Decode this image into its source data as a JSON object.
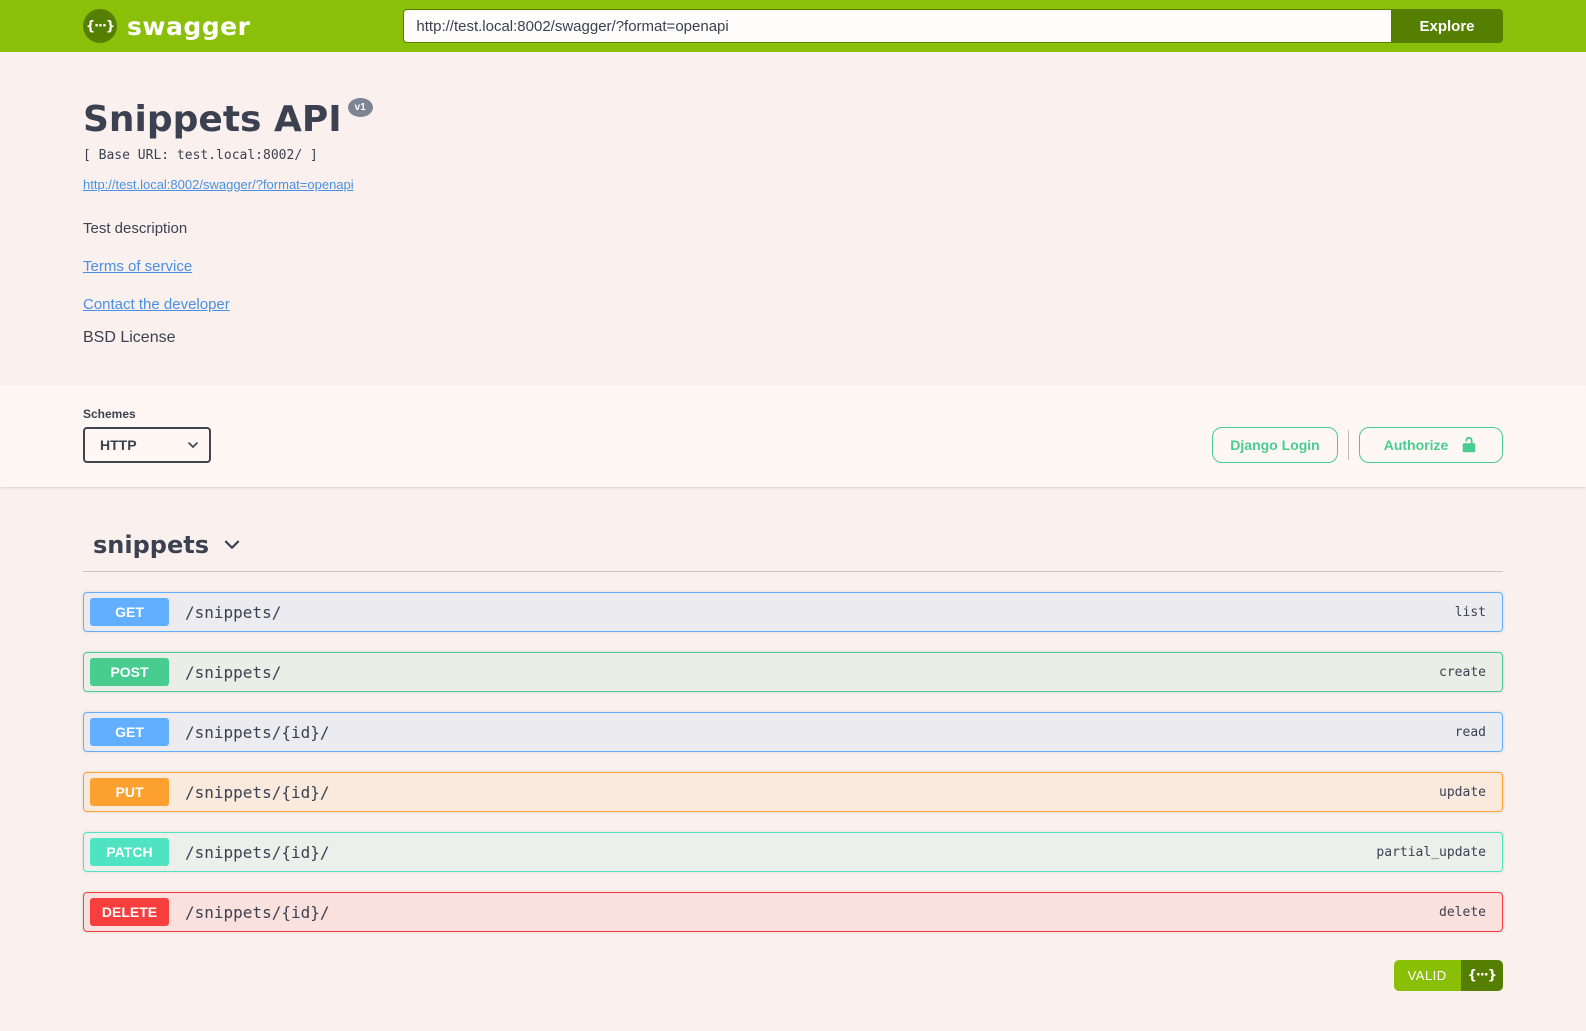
{
  "topbar": {
    "brand": "swagger",
    "logo_glyph": "{···}",
    "url_value": "http://test.local:8002/swagger/?format=openapi",
    "explore_label": "Explore"
  },
  "info": {
    "title": "Snippets API",
    "version_badge": "v1",
    "base_url_text": "[ Base URL: test.local:8002/ ]",
    "spec_link": "http://test.local:8002/swagger/?format=openapi",
    "description": "Test description",
    "terms_link": "Terms of service",
    "contact_link": "Contact the developer",
    "license": "BSD License"
  },
  "schemes": {
    "label": "Schemes",
    "selected": "HTTP"
  },
  "auth": {
    "django_login_label": "Django Login",
    "authorize_label": "Authorize"
  },
  "tag": {
    "name": "snippets"
  },
  "operations": [
    {
      "method": "GET",
      "path": "/snippets/",
      "summary": "list",
      "color": "#61affe"
    },
    {
      "method": "POST",
      "path": "/snippets/",
      "summary": "create",
      "color": "#49cc90"
    },
    {
      "method": "GET",
      "path": "/snippets/{id}/",
      "summary": "read",
      "color": "#61affe"
    },
    {
      "method": "PUT",
      "path": "/snippets/{id}/",
      "summary": "update",
      "color": "#fca130"
    },
    {
      "method": "PATCH",
      "path": "/snippets/{id}/",
      "summary": "partial_update",
      "color": "#50e3c2"
    },
    {
      "method": "DELETE",
      "path": "/snippets/{id}/",
      "summary": "delete",
      "color": "#f93e3e"
    }
  ],
  "valid_badge": {
    "label": "VALID",
    "braces": "{···}"
  },
  "colors": {
    "topbar_green": "#8bc00a",
    "dark_green": "#547f00",
    "valid_green": "#89bf04",
    "auth_green": "#49cc90",
    "link_blue": "#4990e2",
    "text_dark": "#3b4151",
    "page_bg": "#faf1ee",
    "band_bg": "#fef7f4",
    "get_blue": "#61affe",
    "post_green": "#49cc90",
    "put_orange": "#fca130",
    "patch_teal": "#50e3c2",
    "delete_red": "#f93e3e"
  }
}
